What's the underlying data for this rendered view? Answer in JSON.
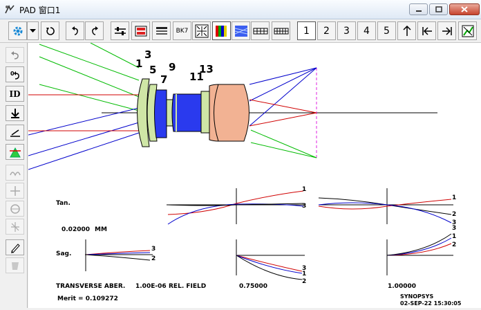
{
  "window": {
    "title": "PAD 窗口1",
    "icon": "pad-app-icon"
  },
  "window_controls": [
    "minimize-icon",
    "maximize-icon",
    "close-icon"
  ],
  "toolbar": {
    "glass_label": "BK7",
    "page_numbers": [
      "1",
      "2",
      "3",
      "4",
      "5"
    ],
    "selected_page": "1",
    "icons": [
      "gear-icon",
      "dropdown-arrow-icon",
      "refresh-icon",
      "undo-icon",
      "redo-icon",
      "adjust-icon",
      "field-icon",
      "list-icon",
      "glass-icon",
      "zoom-fit-icon",
      "color-bars-icon",
      "pattern-icon",
      "table-icon",
      "grid-icon",
      "up-arrow-icon",
      "first-icon",
      "last-icon",
      "graph-icon"
    ]
  },
  "left_tools": {
    "id_label": "ID"
  },
  "lens": {
    "surface_labels": [
      "1",
      "3",
      "5",
      "7",
      "9",
      "11",
      "13"
    ]
  },
  "plots": {
    "tan_label": "Tan.",
    "sag_label": "Sag.",
    "scale_value": "0.02000",
    "scale_unit": "MM",
    "footer_left": "TRANSVERSE ABER.",
    "wavelength": "1.00E-06",
    "field_label": "REL. FIELD",
    "field_mid": "0.75000",
    "field_full": "1.00000",
    "merit": "Merit = 0.109272",
    "brand": "SYNOPSYS",
    "datetime": "02-SEP-22  15:30:05",
    "curve_labels": {
      "tan_1": [
        "1",
        "3"
      ],
      "tan_2": [
        "1",
        "2",
        "3"
      ],
      "sag_0": [
        "3",
        "2"
      ],
      "sag_1": [
        "3",
        "1",
        "2"
      ],
      "sag_2": [
        "3",
        "1",
        "2"
      ]
    }
  },
  "colors": {
    "ray_blue": "#0000cc",
    "ray_red": "#d00000",
    "ray_green": "#00bb00",
    "glass_green": "#cfe6a6",
    "glass_blue": "#2a3aee",
    "glass_salmon": "#f2b293",
    "focus_magenta": "#e020e0"
  }
}
